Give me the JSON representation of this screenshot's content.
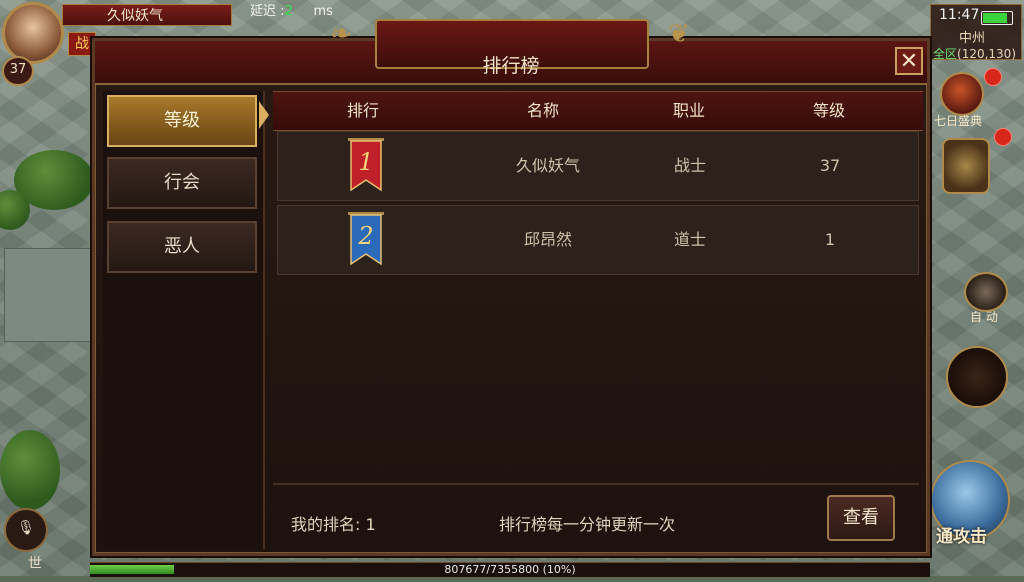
{
  "hud": {
    "player_name": "久似妖气",
    "level": "37",
    "class_badge": "战",
    "ping_label": "延迟 :",
    "ping_value": "2",
    "ping_unit": "ms",
    "time": "11:47",
    "map_name": "中州",
    "zone": "全区",
    "coords": "(120,130)",
    "seven_day_label": "七日盛典",
    "auto_label": "自 动",
    "attack_label": "通攻击",
    "world_chat": "世",
    "exp_text": "807677/7355800 (10%)",
    "exp_fraction": 0.1
  },
  "modal": {
    "title": "排行榜",
    "close_glyph": "✕",
    "tabs": [
      {
        "label": "等级",
        "active": true
      },
      {
        "label": "行会",
        "active": false
      },
      {
        "label": "恶人",
        "active": false
      }
    ],
    "columns": [
      "排行",
      "名称",
      "职业",
      "等级"
    ],
    "rows": [
      {
        "rank": "1",
        "name": "久似妖气",
        "class": "战士",
        "level": "37",
        "flag_color": "#c0202a"
      },
      {
        "rank": "2",
        "name": "邱昂然",
        "class": "道士",
        "level": "1",
        "flag_color": "#2a6ab8"
      }
    ],
    "my_rank": "我的排名: 1",
    "update_note": "排行榜每一分钟更新一次",
    "view_button": "查看"
  },
  "icons": [
    "avatar",
    "close-icon",
    "rank-flag-icon",
    "dragon-ornament-icon",
    "seven-day-icon",
    "auto-icon",
    "attack-icon",
    "mic-icon",
    "battery-icon"
  ]
}
